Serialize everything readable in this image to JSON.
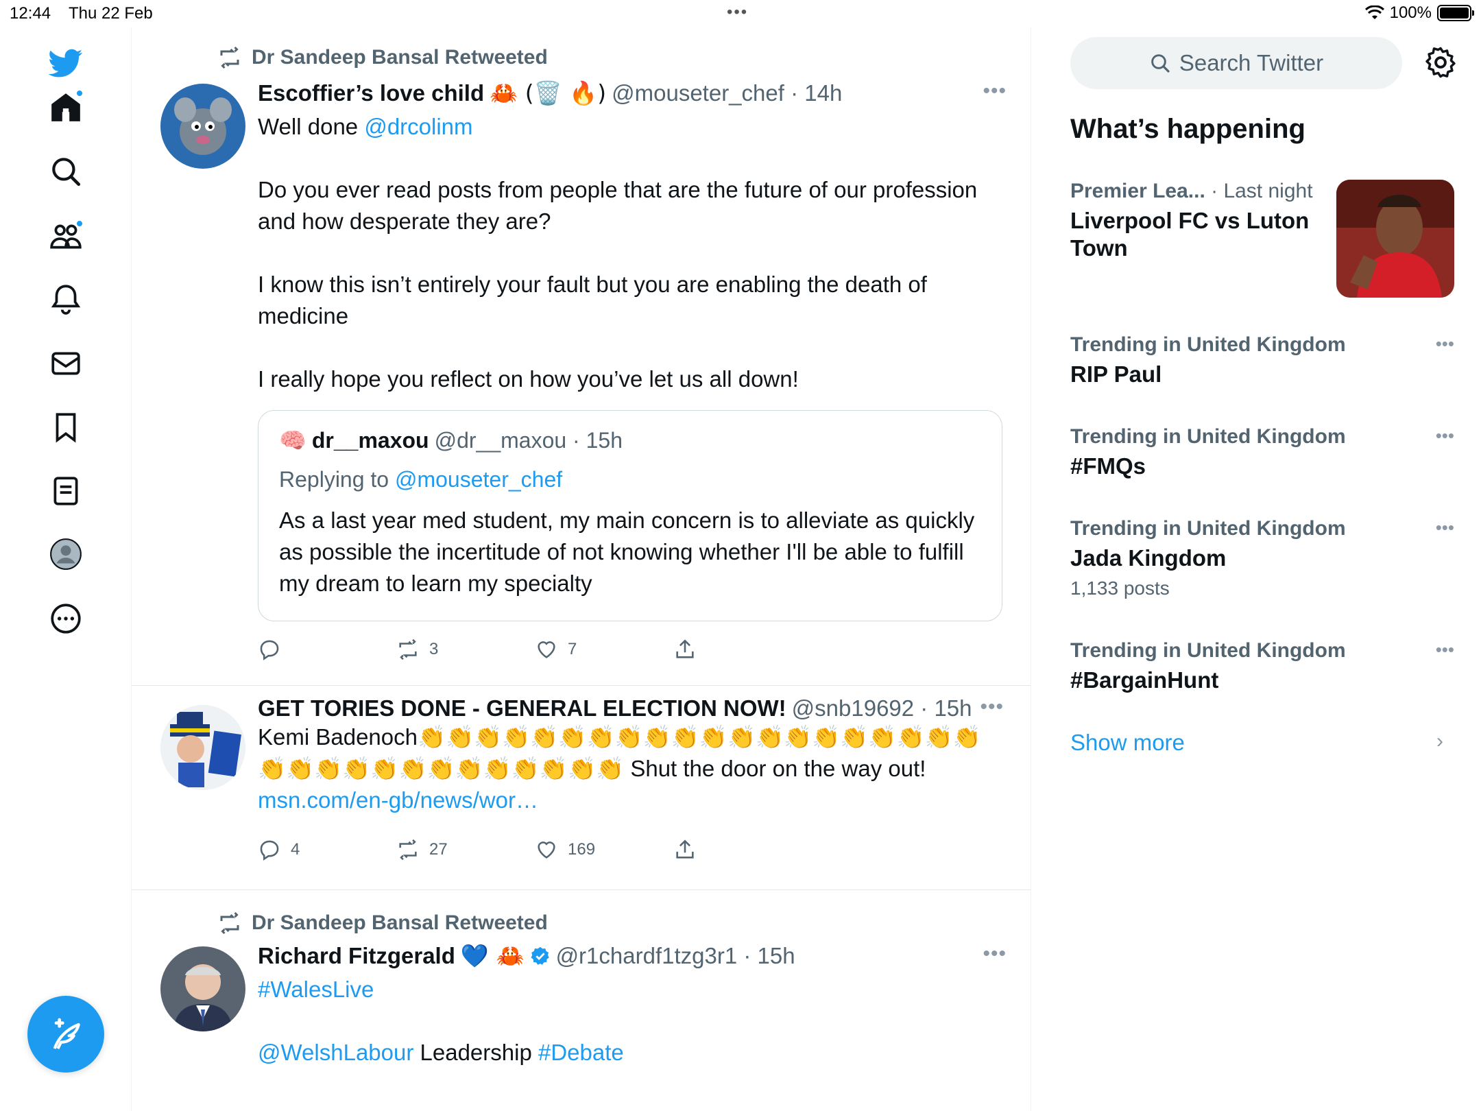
{
  "status": {
    "time": "12:44",
    "date": "Thu 22 Feb",
    "battery": "100%"
  },
  "nav": {
    "icons": [
      "twitter-logo-icon",
      "home-icon",
      "search-icon",
      "communities-icon",
      "notifications-icon",
      "messages-icon",
      "bookmarks-icon",
      "lists-icon",
      "profile-icon",
      "more-icon"
    ],
    "accent": "#1d9bf0"
  },
  "tweets": [
    {
      "retweeted_by": "Dr Sandeep Bansal Retweeted",
      "name": "Escoffier’s love child",
      "name_emoji": "🦀 (🗑️ 🔥)",
      "handle_time": "@mouseter_chef · 14h",
      "lines": [
        {
          "pre": "Well done ",
          "link": "@drcolinm"
        },
        {
          "text": "Do you ever read posts from people that are the future of our profession and how desperate they are?"
        },
        {
          "text": "I know this isn’t entirely your fault but you are enabling the death of medicine"
        },
        {
          "text": "I really hope you reflect on how you’ve let us all down!"
        }
      ],
      "quote": {
        "name": "dr__maxou",
        "handle_time": "@dr__maxou · 15h",
        "reply_prefix": "Replying to ",
        "reply_link": "@mouseter_chef",
        "text": "As a last year med student, my main concern is to alleviate as quickly as possible the incertitude of not knowing whether I'll be able to fulfill my dream to learn my specialty"
      },
      "stats": {
        "replies": "",
        "retweets": "3",
        "likes": "7"
      }
    },
    {
      "name": "GET TORIES DONE - GENERAL ELECTION NOW!",
      "handle_time": "@snb19692 · 15h",
      "text_pre": "Kemi Badenoch",
      "clap_count": 33,
      "text_post": " Shut the door on the way out! ",
      "link": "msn.com/en-gb/news/wor…",
      "stats": {
        "replies": "4",
        "retweets": "27",
        "likes": "169"
      }
    },
    {
      "retweeted_by": "Dr Sandeep Bansal Retweeted",
      "name": "Richard Fitzgerald",
      "name_emoji": "💙 🦀",
      "handle_time": "@r1chardf1tzg3r1 · 15h",
      "hashtag": "#WalesLive",
      "line2_link1": "@WelshLabour",
      "line2_text": " Leadership ",
      "line2_link2": "#Debate"
    }
  ],
  "sidebar": {
    "search_placeholder": "Search Twitter",
    "title": "What’s happening",
    "trends": [
      {
        "context": "Premier Lea...",
        "context_extra": " · Last night",
        "topic": "Liverpool FC vs Luton Town"
      },
      {
        "context": "Trending in United Kingdom",
        "topic": "RIP Paul"
      },
      {
        "context": "Trending in United Kingdom",
        "topic": "#FMQs"
      },
      {
        "context": "Trending in United Kingdom",
        "topic": "Jada Kingdom",
        "count": "1,133 posts"
      },
      {
        "context": "Trending in United Kingdom",
        "topic": "#BargainHunt"
      }
    ],
    "show_more": "Show more"
  }
}
